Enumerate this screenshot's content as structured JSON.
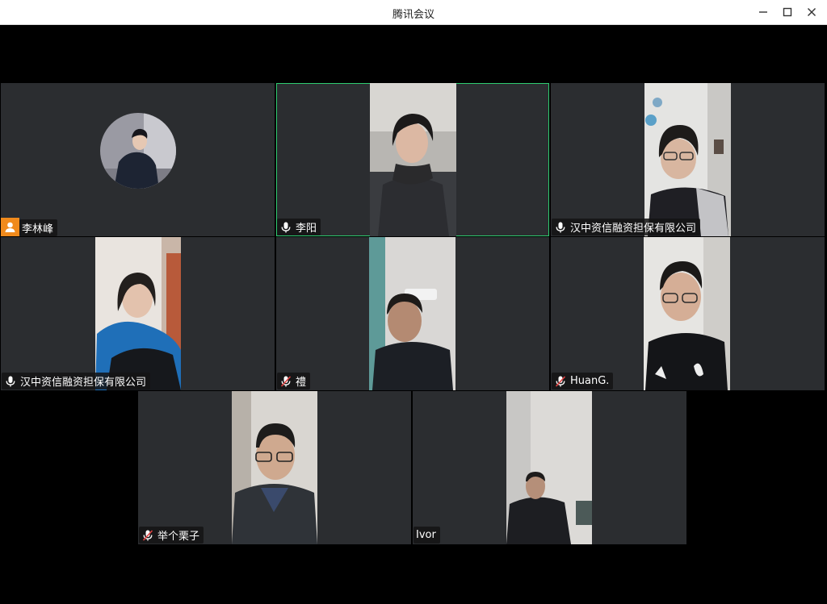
{
  "window": {
    "title": "腾讯会议",
    "controls": [
      "minimize-icon",
      "maximize-icon",
      "close-icon"
    ]
  },
  "participants": [
    {
      "name": "李林峰",
      "status": "avatar",
      "icon": "user-avatar-icon",
      "speaking": false
    },
    {
      "name": "李阳",
      "status": "mic-on",
      "icon": "microphone-icon",
      "speaking": true
    },
    {
      "name": "汉中资信融资担保有限公司",
      "status": "mic-on",
      "icon": "microphone-icon",
      "speaking": false
    },
    {
      "name": "汉中资信融资担保有限公司",
      "status": "mic-on",
      "icon": "microphone-icon",
      "speaking": false
    },
    {
      "name": "禮",
      "status": "mic-muted",
      "icon": "microphone-muted-icon",
      "speaking": false
    },
    {
      "name": "HuanG.",
      "status": "mic-muted",
      "icon": "microphone-muted-icon",
      "speaking": false
    },
    {
      "name": "举个栗子",
      "status": "mic-muted",
      "icon": "microphone-muted-icon",
      "speaking": false
    },
    {
      "name": "Ivor",
      "status": "none",
      "icon": "",
      "speaking": false
    }
  ],
  "colors": {
    "active_border": "#2ecc71",
    "tile_bg": "#2b2d30",
    "avatar_badge": "#f08a1c",
    "muted_slash": "#e04040"
  }
}
